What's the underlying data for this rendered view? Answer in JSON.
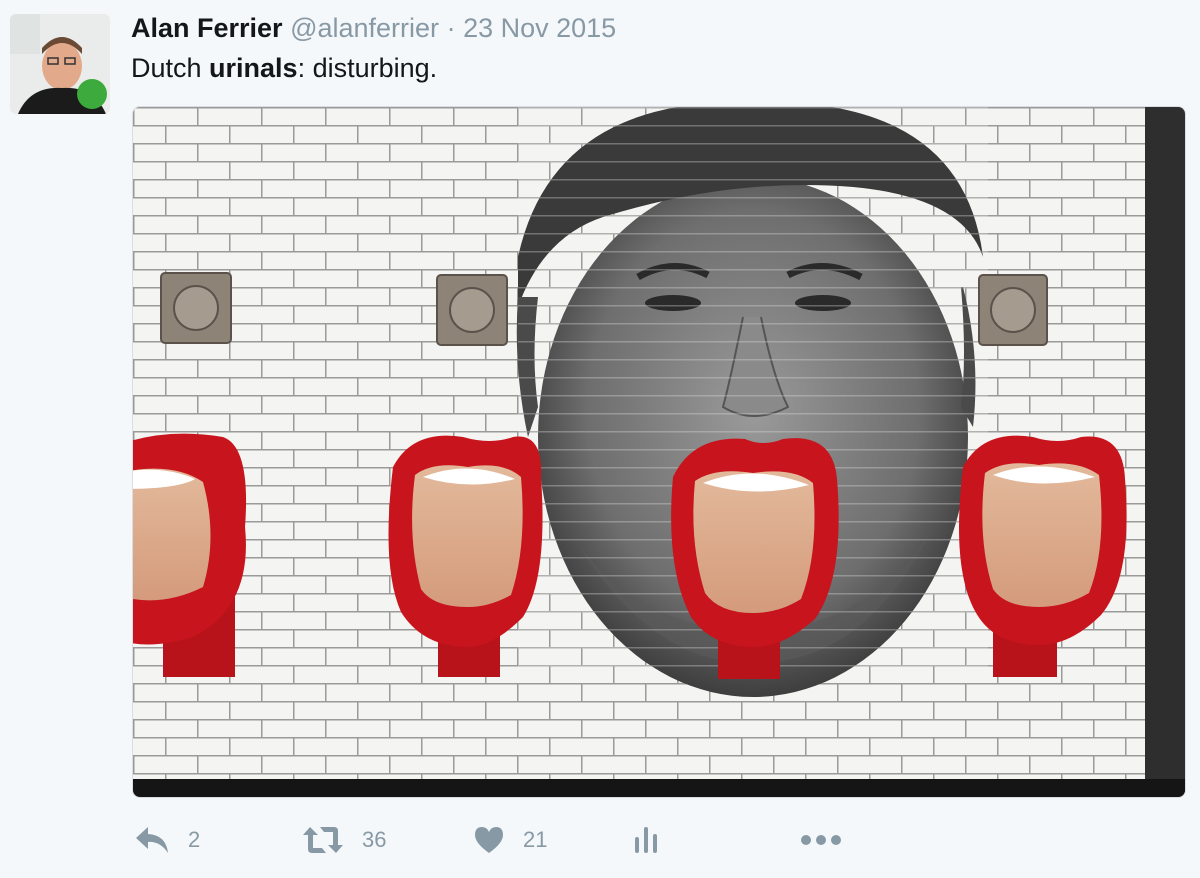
{
  "tweet": {
    "display_name": "Alan Ferrier",
    "handle": "@alanferrier",
    "separator": "·",
    "date": "23 Nov 2015",
    "text_before": "Dutch ",
    "text_bold": "urinals",
    "text_after": ": disturbing."
  },
  "actions": {
    "reply_count": "2",
    "retweet_count": "36",
    "like_count": "21"
  },
  "icons": {
    "reply": "reply-icon",
    "retweet": "retweet-icon",
    "like": "heart-icon",
    "analytics": "analytics-icon",
    "more": "more-icon"
  },
  "colors": {
    "background": "#f5f8fa",
    "text": "#14171a",
    "muted": "#8899a6",
    "lip_red": "#c8141c"
  }
}
